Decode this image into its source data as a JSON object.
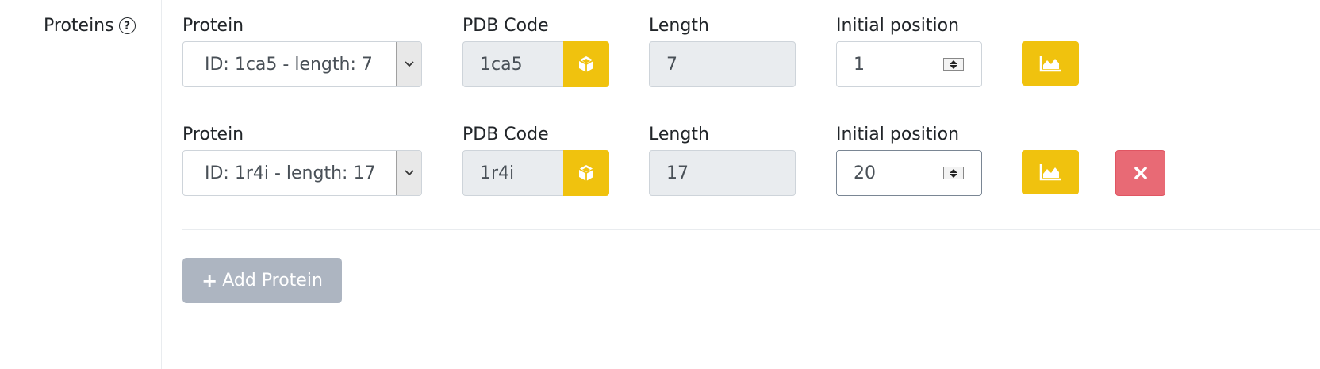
{
  "section": {
    "label": "Proteins",
    "help_icon": "?"
  },
  "columns": {
    "protein": "Protein",
    "pdb_code": "PDB Code",
    "length": "Length",
    "initial_position": "Initial position"
  },
  "rows": [
    {
      "protein": "ID: 1ca5 - length: 7",
      "pdb_code": "1ca5",
      "length": "7",
      "initial_position": "1",
      "removable": false
    },
    {
      "protein": "ID: 1r4i - length: 17",
      "pdb_code": "1r4i",
      "length": "17",
      "initial_position": "20",
      "removable": true
    }
  ],
  "icons": {
    "pdb_button": "cube-icon",
    "chart_button": "area-chart-icon",
    "remove_button": "times-icon",
    "add_button": "plus-icon",
    "select_arrow": "chevron-down-icon"
  },
  "add_button": {
    "plus": "+",
    "label": "Add Protein"
  },
  "colors": {
    "accent_yellow": "#f0c20e",
    "danger_red": "#e86a75",
    "disabled_button": "#adb5c1",
    "readonly_bg": "#e9ecef"
  }
}
